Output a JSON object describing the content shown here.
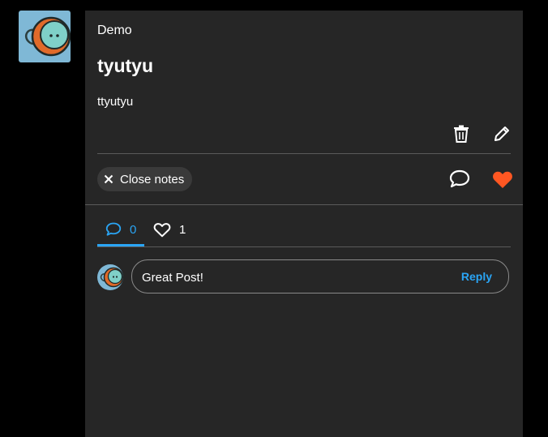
{
  "post": {
    "author": "Demo",
    "title": "tyutyu",
    "body": "ttyutyu"
  },
  "actions": {
    "close_notes_label": "Close notes",
    "icons": [
      "trash-icon",
      "pencil-icon",
      "chat-bubble-icon",
      "heart-icon"
    ]
  },
  "tabs": [
    {
      "icon": "chat-bubble-icon",
      "count": "0",
      "active": true
    },
    {
      "icon": "heart-outline-icon",
      "count": "1",
      "active": false
    }
  ],
  "comment": {
    "placeholder": "Great Post!",
    "reply_label": "Reply"
  },
  "colors": {
    "background": "#000000",
    "card": "#262626",
    "accent": "#2aa5f5",
    "heart": "#ff5722",
    "avatar_bg": "#7fb8d6"
  }
}
